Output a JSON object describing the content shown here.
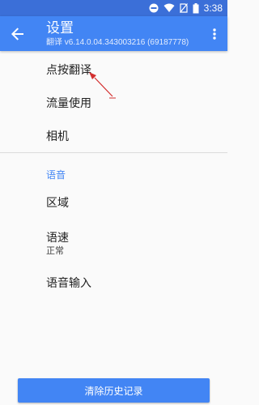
{
  "status_bar": {
    "time": "3:38",
    "icons": [
      "do-not-disturb-icon",
      "wifi-icon",
      "no-sim-icon",
      "battery-icon"
    ],
    "color": "#3b6fd8"
  },
  "toolbar": {
    "title": "设置",
    "subtitle": "翻译 v6.14.0.04.343003216 (69187778)",
    "back_icon": "arrow-back-icon",
    "more_icon": "more-vert-icon",
    "color": "#4285f4"
  },
  "general_items": [
    {
      "label": "点按翻译"
    },
    {
      "label": "流量使用"
    },
    {
      "label": "相机"
    }
  ],
  "voice_section": {
    "header": "语音",
    "items": [
      {
        "label": "区域"
      },
      {
        "label": "语速",
        "value": "正常"
      },
      {
        "label": "语音输入"
      }
    ]
  },
  "footer": {
    "clear_history_label": "清除历史记录"
  },
  "annotation": {
    "arrow_color": "#d32f2f"
  }
}
